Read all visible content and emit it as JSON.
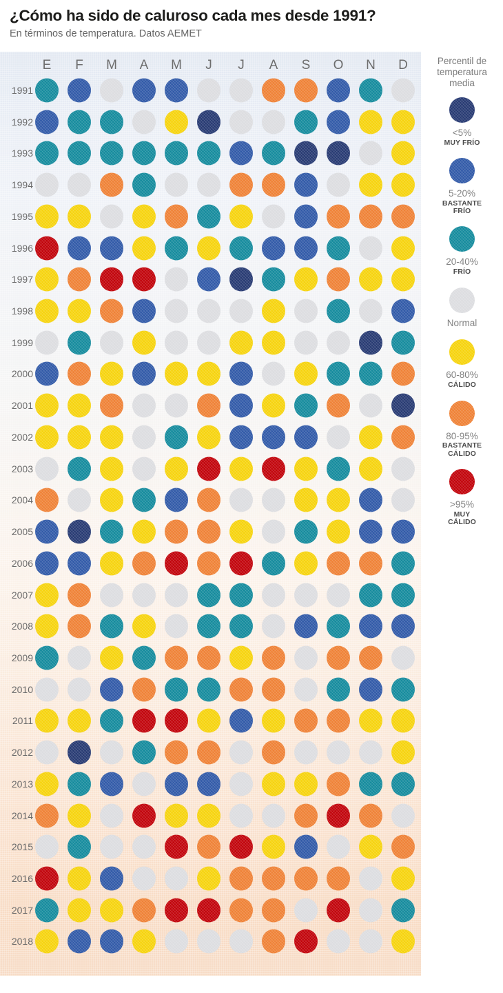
{
  "header": {
    "title": "¿Cómo ha sido de caluroso cada mes desde 1991?",
    "subtitle": "En términos de temperatura. Datos AEMET"
  },
  "legend": {
    "title": "Percentil de temperatura media",
    "items": [
      {
        "range": "<5%",
        "name": "MUY FRÍO",
        "color": "#253871"
      },
      {
        "range": "5-20%",
        "name": "BASTANTE\nFRÍO",
        "color": "#2f58a7"
      },
      {
        "range": "20-40%",
        "name": "FRÍO",
        "color": "#128a9c"
      },
      {
        "range": "Normal",
        "name": "",
        "color": "#dcdde0"
      },
      {
        "range": "60-80%",
        "name": "CÁLIDO",
        "color": "#f6d30b"
      },
      {
        "range": "80-95%",
        "name": "BASTANTE\nCÁLIDO",
        "color": "#ef8034"
      },
      {
        "range": ">95%",
        "name": "MUY\nCÁLIDO",
        "color": "#c10008"
      }
    ]
  },
  "chart_data": {
    "type": "heatmap",
    "title": "¿Cómo ha sido de caluroso cada mes desde 1991?",
    "subtitle": "En términos de temperatura. Datos AEMET",
    "xlabel": "",
    "ylabel": "",
    "grid": false,
    "legend_position": "right",
    "value_scale": "Percentil de temperatura media",
    "categories": [
      "E",
      "F",
      "M",
      "A",
      "M",
      "J",
      "J",
      "A",
      "S",
      "O",
      "N",
      "D"
    ],
    "category_names": [
      "Enero",
      "Febrero",
      "Marzo",
      "Abril",
      "Mayo",
      "Junio",
      "Julio",
      "Agosto",
      "Septiembre",
      "Octubre",
      "Noviembre",
      "Diciembre"
    ],
    "rows": [
      "1991",
      "1992",
      "1993",
      "1994",
      "1995",
      "1996",
      "1997",
      "1998",
      "1999",
      "2000",
      "2001",
      "2002",
      "2003",
      "2004",
      "2005",
      "2006",
      "2007",
      "2008",
      "2009",
      "2010",
      "2011",
      "2012",
      "2013",
      "2014",
      "2015",
      "2016",
      "2017",
      "2018"
    ],
    "class_keys": [
      "muy_frio",
      "bastante_frio",
      "frio",
      "normal",
      "calido",
      "bastante_calido",
      "muy_calido"
    ],
    "class_colors": {
      "muy_frio": "#253871",
      "bastante_frio": "#2f58a7",
      "frio": "#128a9c",
      "normal": "#dcdde0",
      "calido": "#f6d30b",
      "bastante_calido": "#ef8034",
      "muy_calido": "#c10008"
    },
    "values": [
      [
        "frio",
        "bastante_frio",
        "normal",
        "bastante_frio",
        "bastante_frio",
        "normal",
        "normal",
        "bastante_calido",
        "bastante_calido",
        "bastante_frio",
        "frio",
        "normal"
      ],
      [
        "bastante_frio",
        "frio",
        "frio",
        "normal",
        "calido",
        "muy_frio",
        "normal",
        "normal",
        "frio",
        "bastante_frio",
        "calido",
        "calido"
      ],
      [
        "frio",
        "frio",
        "frio",
        "frio",
        "frio",
        "frio",
        "bastante_frio",
        "frio",
        "muy_frio",
        "muy_frio",
        "normal",
        "calido"
      ],
      [
        "normal",
        "normal",
        "bastante_calido",
        "frio",
        "normal",
        "normal",
        "bastante_calido",
        "bastante_calido",
        "bastante_frio",
        "normal",
        "calido",
        "calido"
      ],
      [
        "calido",
        "calido",
        "normal",
        "calido",
        "bastante_calido",
        "frio",
        "calido",
        "normal",
        "bastante_frio",
        "bastante_calido",
        "bastante_calido",
        "bastante_calido"
      ],
      [
        "muy_calido",
        "bastante_frio",
        "bastante_frio",
        "calido",
        "frio",
        "calido",
        "frio",
        "bastante_frio",
        "bastante_frio",
        "frio",
        "normal",
        "calido"
      ],
      [
        "calido",
        "bastante_calido",
        "muy_calido",
        "muy_calido",
        "normal",
        "bastante_frio",
        "muy_frio",
        "frio",
        "calido",
        "bastante_calido",
        "calido",
        "calido"
      ],
      [
        "calido",
        "calido",
        "bastante_calido",
        "bastante_frio",
        "normal",
        "normal",
        "normal",
        "calido",
        "normal",
        "frio",
        "normal",
        "bastante_frio"
      ],
      [
        "normal",
        "frio",
        "normal",
        "calido",
        "normal",
        "normal",
        "calido",
        "calido",
        "normal",
        "normal",
        "muy_frio",
        "frio"
      ],
      [
        "bastante_frio",
        "bastante_calido",
        "calido",
        "bastante_frio",
        "calido",
        "calido",
        "bastante_frio",
        "normal",
        "calido",
        "frio",
        "frio",
        "bastante_calido"
      ],
      [
        "calido",
        "calido",
        "bastante_calido",
        "normal",
        "normal",
        "bastante_calido",
        "bastante_frio",
        "calido",
        "frio",
        "bastante_calido",
        "normal",
        "muy_frio"
      ],
      [
        "calido",
        "calido",
        "calido",
        "normal",
        "frio",
        "calido",
        "bastante_frio",
        "bastante_frio",
        "bastante_frio",
        "normal",
        "calido",
        "bastante_calido"
      ],
      [
        "normal",
        "frio",
        "calido",
        "normal",
        "calido",
        "muy_calido",
        "calido",
        "muy_calido",
        "calido",
        "frio",
        "calido",
        "normal"
      ],
      [
        "bastante_calido",
        "normal",
        "calido",
        "frio",
        "bastante_frio",
        "bastante_calido",
        "normal",
        "normal",
        "calido",
        "calido",
        "bastante_frio",
        "normal"
      ],
      [
        "bastante_frio",
        "muy_frio",
        "frio",
        "calido",
        "bastante_calido",
        "bastante_calido",
        "calido",
        "normal",
        "frio",
        "calido",
        "bastante_frio",
        "bastante_frio"
      ],
      [
        "bastante_frio",
        "bastante_frio",
        "calido",
        "bastante_calido",
        "muy_calido",
        "bastante_calido",
        "muy_calido",
        "frio",
        "calido",
        "bastante_calido",
        "bastante_calido",
        "frio"
      ],
      [
        "calido",
        "bastante_calido",
        "normal",
        "normal",
        "normal",
        "frio",
        "frio",
        "normal",
        "normal",
        "normal",
        "frio",
        "frio"
      ],
      [
        "calido",
        "bastante_calido",
        "frio",
        "calido",
        "normal",
        "frio",
        "frio",
        "normal",
        "bastante_frio",
        "frio",
        "bastante_frio",
        "bastante_frio"
      ],
      [
        "frio",
        "normal",
        "calido",
        "frio",
        "bastante_calido",
        "bastante_calido",
        "calido",
        "bastante_calido",
        "normal",
        "bastante_calido",
        "bastante_calido",
        "normal"
      ],
      [
        "normal",
        "normal",
        "bastante_frio",
        "bastante_calido",
        "frio",
        "frio",
        "bastante_calido",
        "bastante_calido",
        "normal",
        "frio",
        "bastante_frio",
        "frio"
      ],
      [
        "calido",
        "calido",
        "frio",
        "muy_calido",
        "muy_calido",
        "calido",
        "bastante_frio",
        "calido",
        "bastante_calido",
        "bastante_calido",
        "calido",
        "calido"
      ],
      [
        "normal",
        "muy_frio",
        "normal",
        "frio",
        "bastante_calido",
        "bastante_calido",
        "normal",
        "bastante_calido",
        "normal",
        "normal",
        "normal",
        "calido"
      ],
      [
        "calido",
        "frio",
        "bastante_frio",
        "normal",
        "bastante_frio",
        "bastante_frio",
        "normal",
        "calido",
        "calido",
        "bastante_calido",
        "frio",
        "frio"
      ],
      [
        "bastante_calido",
        "calido",
        "normal",
        "muy_calido",
        "calido",
        "calido",
        "normal",
        "normal",
        "bastante_calido",
        "muy_calido",
        "bastante_calido",
        "normal"
      ],
      [
        "normal",
        "frio",
        "normal",
        "normal",
        "muy_calido",
        "bastante_calido",
        "muy_calido",
        "calido",
        "bastante_frio",
        "normal",
        "calido",
        "bastante_calido"
      ],
      [
        "muy_calido",
        "calido",
        "bastante_frio",
        "normal",
        "normal",
        "calido",
        "bastante_calido",
        "bastante_calido",
        "bastante_calido",
        "bastante_calido",
        "normal",
        "calido"
      ],
      [
        "frio",
        "calido",
        "calido",
        "bastante_calido",
        "muy_calido",
        "muy_calido",
        "bastante_calido",
        "bastante_calido",
        "normal",
        "muy_calido",
        "normal",
        "frio"
      ],
      [
        "calido",
        "bastante_frio",
        "bastante_frio",
        "calido",
        "normal",
        "normal",
        "normal",
        "bastante_calido",
        "muy_calido",
        "normal",
        "normal",
        "calido"
      ]
    ]
  }
}
